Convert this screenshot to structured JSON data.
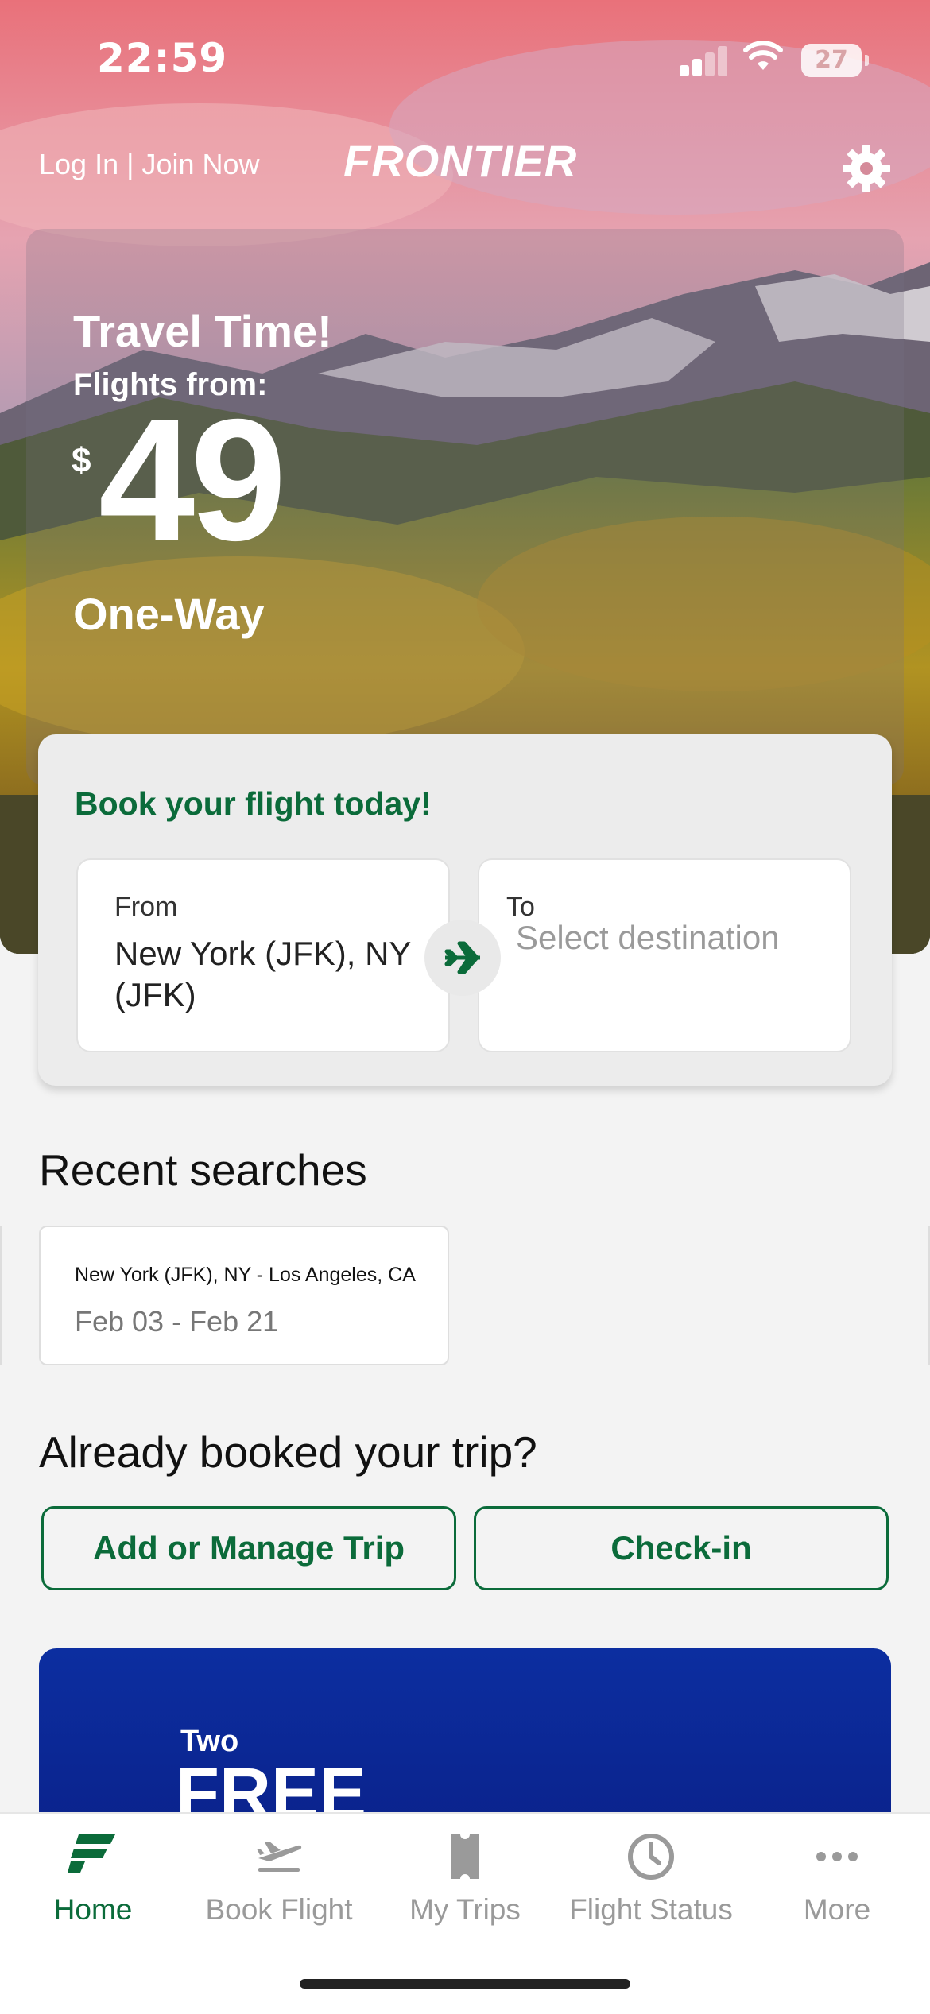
{
  "status_bar": {
    "time": "22:59",
    "battery": "27"
  },
  "header": {
    "login_text": "Log In | Join Now",
    "logo": "FRONTIER",
    "settings_icon": "gear-icon"
  },
  "promo": {
    "title": "Travel Time!",
    "subtitle": "Flights from:",
    "currency": "$",
    "price": "49",
    "trip_type": "One-Way"
  },
  "booking": {
    "title": "Book your flight today!",
    "from_label": "From",
    "from_value": "New York (JFK), NY (JFK)",
    "to_label": "To",
    "to_placeholder": "Select destination",
    "swap_icon": "airplane-icon"
  },
  "recent": {
    "heading": "Recent searches",
    "items": [
      {
        "route": "New York (JFK), NY - Los Angeles, CA",
        "dates": "Feb 03 - Feb 21"
      }
    ]
  },
  "booked": {
    "heading": "Already booked your trip?",
    "manage_label": "Add or Manage Trip",
    "checkin_label": "Check-in"
  },
  "banner": {
    "line1": "Two",
    "line2": "FREE"
  },
  "tabs": [
    {
      "label": "Home",
      "icon": "frontier-logo-icon",
      "active": true
    },
    {
      "label": "Book Flight",
      "icon": "plane-takeoff-icon",
      "active": false
    },
    {
      "label": "My Trips",
      "icon": "ticket-icon",
      "active": false
    },
    {
      "label": "Flight Status",
      "icon": "clock-icon",
      "active": false
    },
    {
      "label": "More",
      "icon": "more-dots-icon",
      "active": false
    }
  ],
  "colors": {
    "brand_green": "#0b6b3a",
    "banner_blue": "#0a1f86"
  }
}
